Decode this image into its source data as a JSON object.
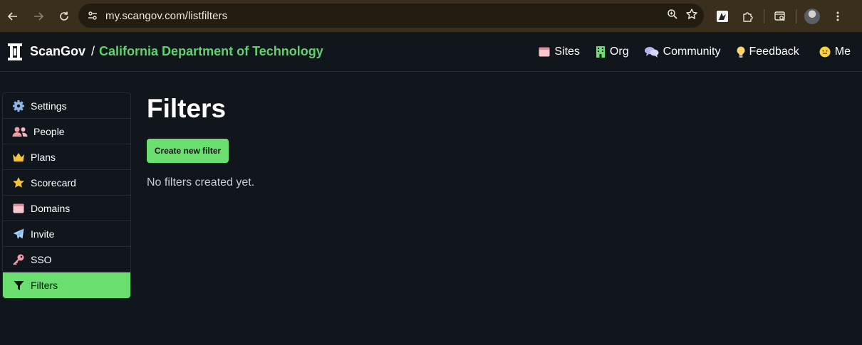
{
  "browser": {
    "url": "my.scangov.com/listfilters"
  },
  "header": {
    "brand": "ScanGov",
    "separator": "/",
    "org_name": "California Department of Technology",
    "nav": [
      {
        "label": "Sites",
        "icon": "browser-window-icon"
      },
      {
        "label": "Org",
        "icon": "building-icon"
      },
      {
        "label": "Community",
        "icon": "speech-bubbles-icon"
      },
      {
        "label": "Feedback",
        "icon": "lightbulb-icon"
      },
      {
        "label": "Me",
        "icon": "smiley-icon"
      }
    ]
  },
  "sidebar": {
    "items": [
      {
        "label": "Settings",
        "icon": "gear-icon"
      },
      {
        "label": "People",
        "icon": "people-icon"
      },
      {
        "label": "Plans",
        "icon": "crown-icon"
      },
      {
        "label": "Scorecard",
        "icon": "star-icon"
      },
      {
        "label": "Domains",
        "icon": "window-icon"
      },
      {
        "label": "Invite",
        "icon": "paper-plane-icon"
      },
      {
        "label": "SSO",
        "icon": "key-icon"
      },
      {
        "label": "Filters",
        "icon": "funnel-icon",
        "active": true
      }
    ]
  },
  "main": {
    "title": "Filters",
    "create_button": "Create new filter",
    "empty_message": "No filters created yet."
  },
  "colors": {
    "accent": "#6ade6f",
    "org_name": "#5fd36a",
    "background": "#11151c",
    "chrome": "#3a2f1c"
  }
}
